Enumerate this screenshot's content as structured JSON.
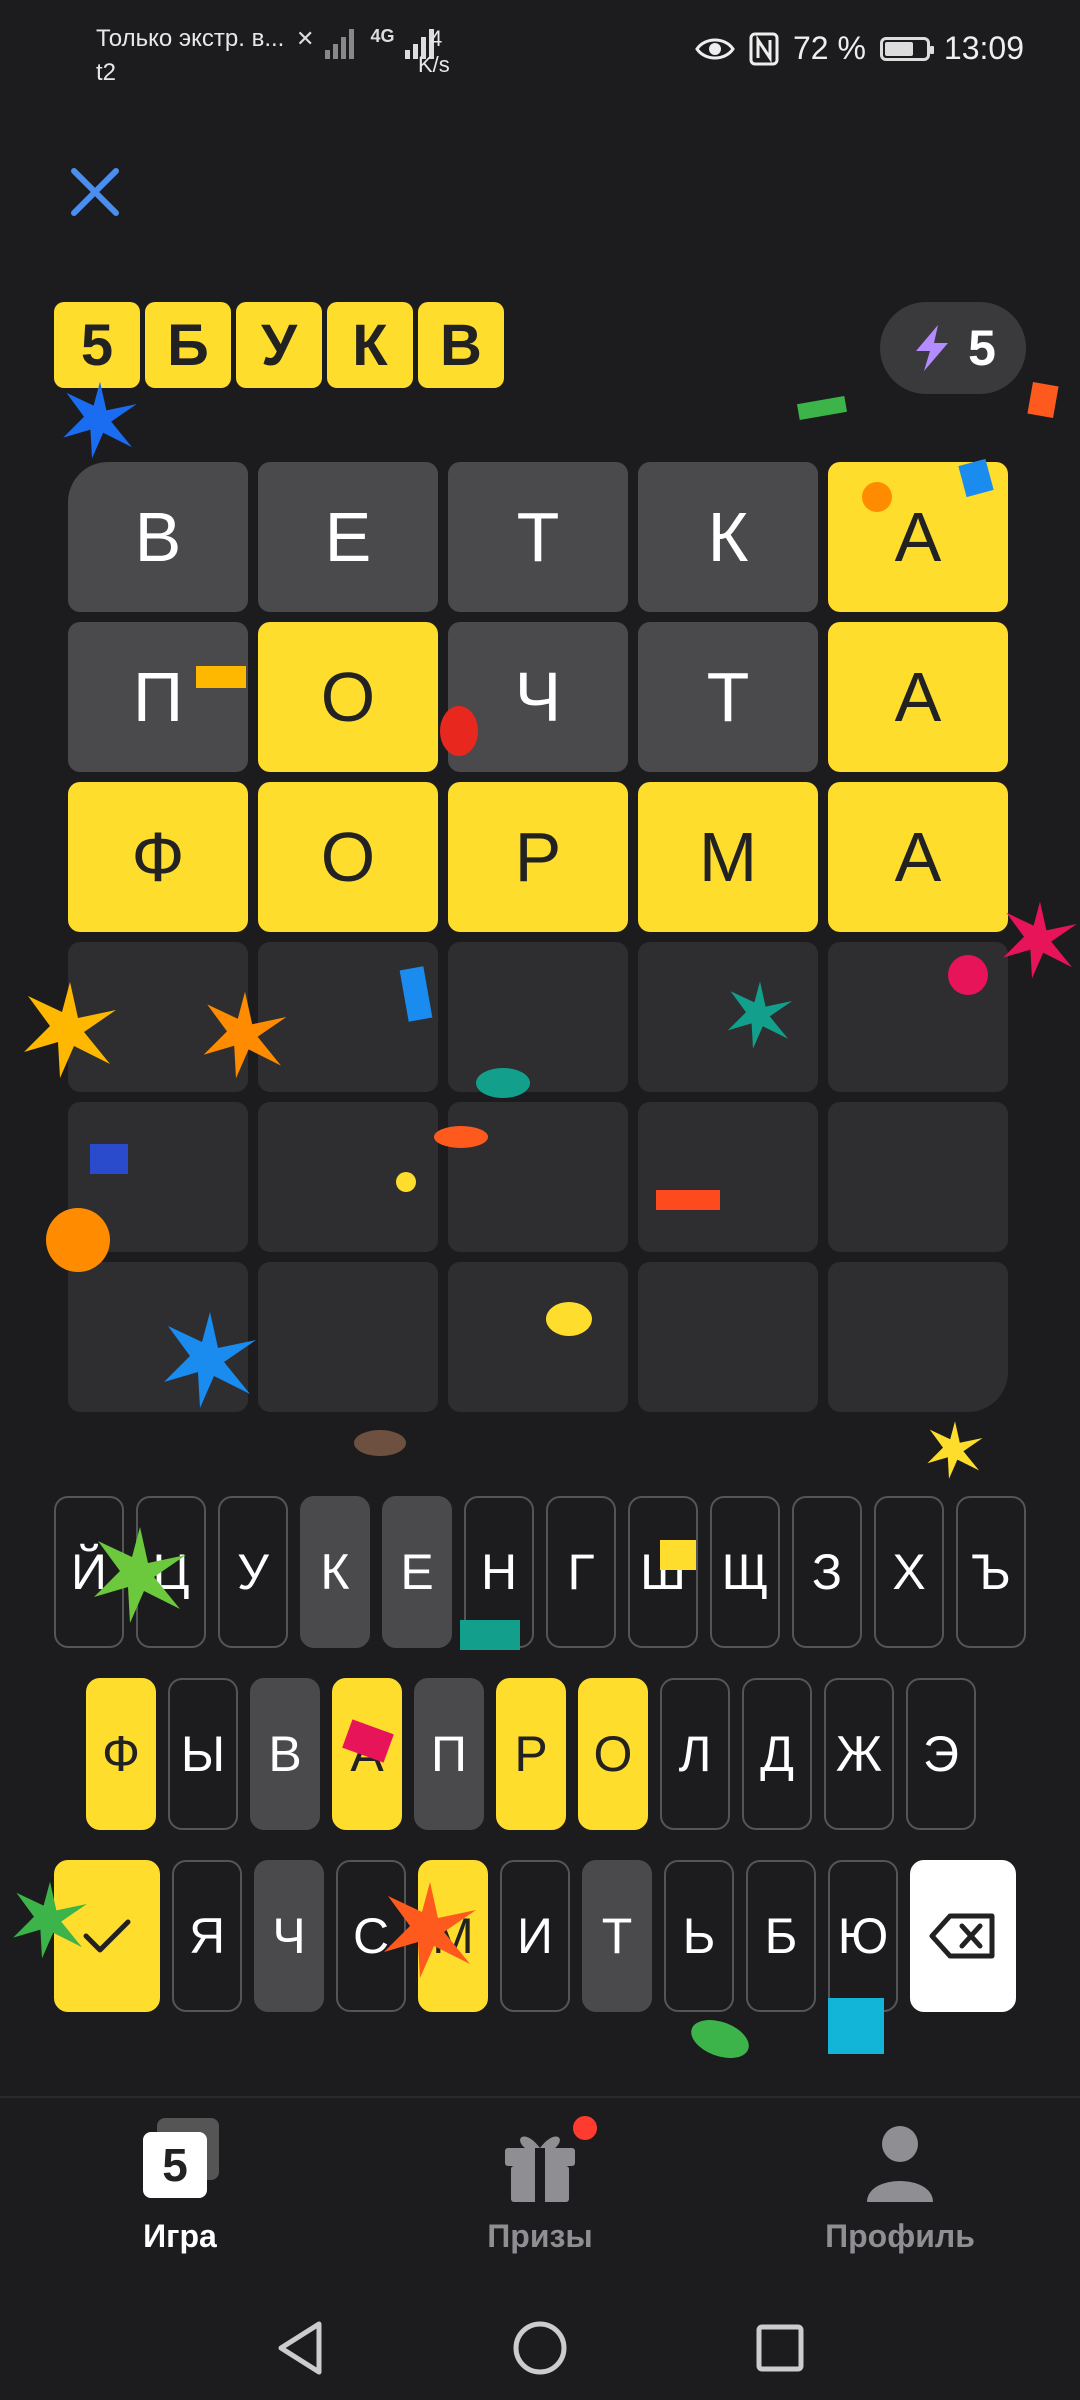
{
  "status_bar": {
    "carrier_line1": "Только экстр. в...",
    "carrier_line2": "t2",
    "network": "4G",
    "speed_value": "4",
    "speed_unit": "K/s",
    "battery": "72 %",
    "battery_level": 0.72,
    "time": "13:09"
  },
  "header": {
    "logo_letters": [
      "5",
      "Б",
      "У",
      "К",
      "В"
    ],
    "energy_count": "5"
  },
  "board": {
    "rows": [
      [
        {
          "l": "В",
          "s": "absent"
        },
        {
          "l": "Е",
          "s": "absent"
        },
        {
          "l": "Т",
          "s": "absent"
        },
        {
          "l": "К",
          "s": "absent"
        },
        {
          "l": "А",
          "s": "correct"
        }
      ],
      [
        {
          "l": "П",
          "s": "absent"
        },
        {
          "l": "О",
          "s": "correct"
        },
        {
          "l": "Ч",
          "s": "absent"
        },
        {
          "l": "Т",
          "s": "absent"
        },
        {
          "l": "А",
          "s": "correct"
        }
      ],
      [
        {
          "l": "Ф",
          "s": "correct"
        },
        {
          "l": "О",
          "s": "correct"
        },
        {
          "l": "Р",
          "s": "correct"
        },
        {
          "l": "М",
          "s": "correct"
        },
        {
          "l": "А",
          "s": "correct"
        }
      ],
      [
        {
          "l": "",
          "s": "empty"
        },
        {
          "l": "",
          "s": "empty"
        },
        {
          "l": "",
          "s": "empty"
        },
        {
          "l": "",
          "s": "empty"
        },
        {
          "l": "",
          "s": "empty"
        }
      ],
      [
        {
          "l": "",
          "s": "empty"
        },
        {
          "l": "",
          "s": "empty"
        },
        {
          "l": "",
          "s": "empty"
        },
        {
          "l": "",
          "s": "empty"
        },
        {
          "l": "",
          "s": "empty"
        }
      ],
      [
        {
          "l": "",
          "s": "empty"
        },
        {
          "l": "",
          "s": "empty"
        },
        {
          "l": "",
          "s": "empty"
        },
        {
          "l": "",
          "s": "empty"
        },
        {
          "l": "",
          "s": "empty"
        }
      ]
    ]
  },
  "keyboard": {
    "row1": [
      {
        "l": "Й",
        "s": ""
      },
      {
        "l": "Ц",
        "s": ""
      },
      {
        "l": "У",
        "s": ""
      },
      {
        "l": "К",
        "s": "absent"
      },
      {
        "l": "Е",
        "s": "absent"
      },
      {
        "l": "Н",
        "s": ""
      },
      {
        "l": "Г",
        "s": ""
      },
      {
        "l": "Ш",
        "s": ""
      },
      {
        "l": "Щ",
        "s": ""
      },
      {
        "l": "З",
        "s": ""
      },
      {
        "l": "Х",
        "s": ""
      },
      {
        "l": "Ъ",
        "s": ""
      }
    ],
    "row2": [
      {
        "l": "Ф",
        "s": "correct"
      },
      {
        "l": "Ы",
        "s": ""
      },
      {
        "l": "В",
        "s": "absent"
      },
      {
        "l": "А",
        "s": "correct"
      },
      {
        "l": "П",
        "s": "absent"
      },
      {
        "l": "Р",
        "s": "correct"
      },
      {
        "l": "О",
        "s": "correct"
      },
      {
        "l": "Л",
        "s": ""
      },
      {
        "l": "Д",
        "s": ""
      },
      {
        "l": "Ж",
        "s": ""
      },
      {
        "l": "Э",
        "s": ""
      }
    ],
    "row3": [
      {
        "l": "Я",
        "s": ""
      },
      {
        "l": "Ч",
        "s": "absent"
      },
      {
        "l": "С",
        "s": ""
      },
      {
        "l": "М",
        "s": "correct"
      },
      {
        "l": "И",
        "s": ""
      },
      {
        "l": "Т",
        "s": "absent"
      },
      {
        "l": "Ь",
        "s": ""
      },
      {
        "l": "Б",
        "s": ""
      },
      {
        "l": "Ю",
        "s": ""
      }
    ],
    "enter_icon": "checkmark-icon",
    "delete_icon": "backspace-icon"
  },
  "bottom_nav": {
    "items": [
      {
        "label": "Игра",
        "icon": "game-icon",
        "active": true,
        "badge_text": "5"
      },
      {
        "label": "Призы",
        "icon": "gift-icon",
        "active": false,
        "has_notification": true
      },
      {
        "label": "Профиль",
        "icon": "profile-icon",
        "active": false
      }
    ]
  },
  "colors": {
    "accent_yellow": "#ffdd2d",
    "tile_gray": "#4a4a4c",
    "background": "#1c1c1e",
    "close_blue": "#4a8ef0",
    "notification_red": "#ff3b30"
  }
}
